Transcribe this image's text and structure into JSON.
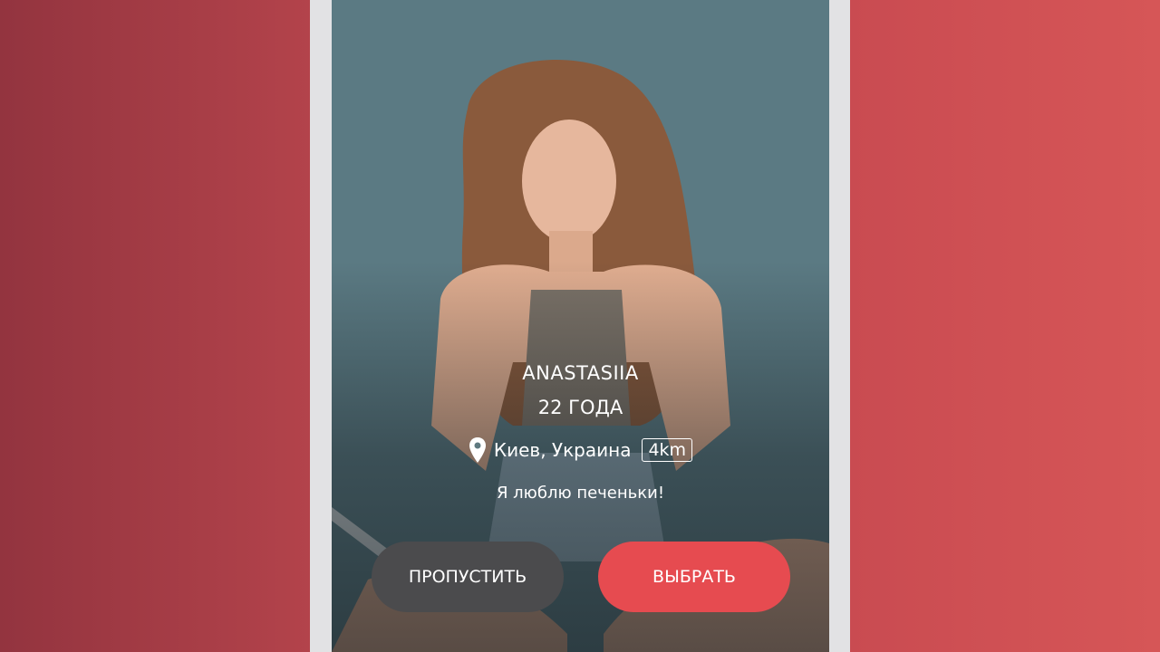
{
  "profile": {
    "name": "ANASTASIIA",
    "age": "22 ГОДА",
    "location": "Киев, Украина",
    "distance": "4km",
    "bio": "Я люблю печеньки!"
  },
  "actions": {
    "skip_label": "ПРОПУСТИТЬ",
    "pick_label": "ВЫБРАТЬ"
  },
  "colors": {
    "accent": "#e64b50",
    "skip_button": "#4b4b4d",
    "background_left": "#a33b45",
    "background_right": "#d05254"
  },
  "icons": {
    "location": "map-pin-icon"
  }
}
